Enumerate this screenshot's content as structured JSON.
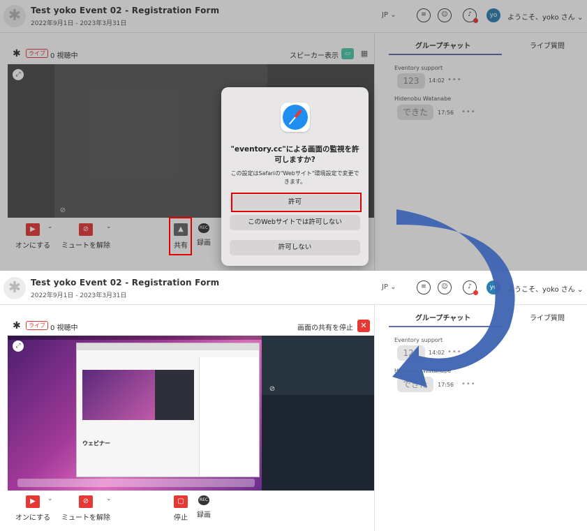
{
  "header": {
    "title": "Test yoko Event 02 - Registration Form",
    "subtitle": "2022年9月1日 - 2023年3月31日",
    "lang": "JP",
    "avatar": "yo",
    "welcome": "ようこそ、yoko さん"
  },
  "video": {
    "live_badge": "ライブ",
    "viewers": "0 視聴中",
    "speaker_view": "スピーカー表示",
    "stop_share": "画面の共有を停止"
  },
  "controls": {
    "camera_on": "オンにする",
    "unmute": "ミュートを解除",
    "share": "共有",
    "record": "録画",
    "stop": "停止",
    "rec_icon": "REC"
  },
  "dialog": {
    "title": "\"eventory.cc\"による画面の監視を許可しますか?",
    "subtitle": "この設定はSafariの\"Webサイト\"環境設定で変更できます。",
    "allow": "許可",
    "deny_site": "このWebサイトでは許可しない",
    "deny": "許可しない"
  },
  "chat": {
    "tab_group": "グループチャット",
    "tab_live": "ライブ質問",
    "messages": [
      {
        "name": "Eventory support",
        "text": "123",
        "time": "14:02"
      },
      {
        "name": "Hidenobu Watanabe",
        "text": "できた",
        "time": "17:56"
      }
    ]
  },
  "shared": {
    "webinar_title": "ウェビナー"
  },
  "icons": {
    "accent": "#4dc8aa",
    "danger": "#e53935",
    "tab_underline": "#5d6ea8",
    "arrow": "#3d63b0"
  }
}
